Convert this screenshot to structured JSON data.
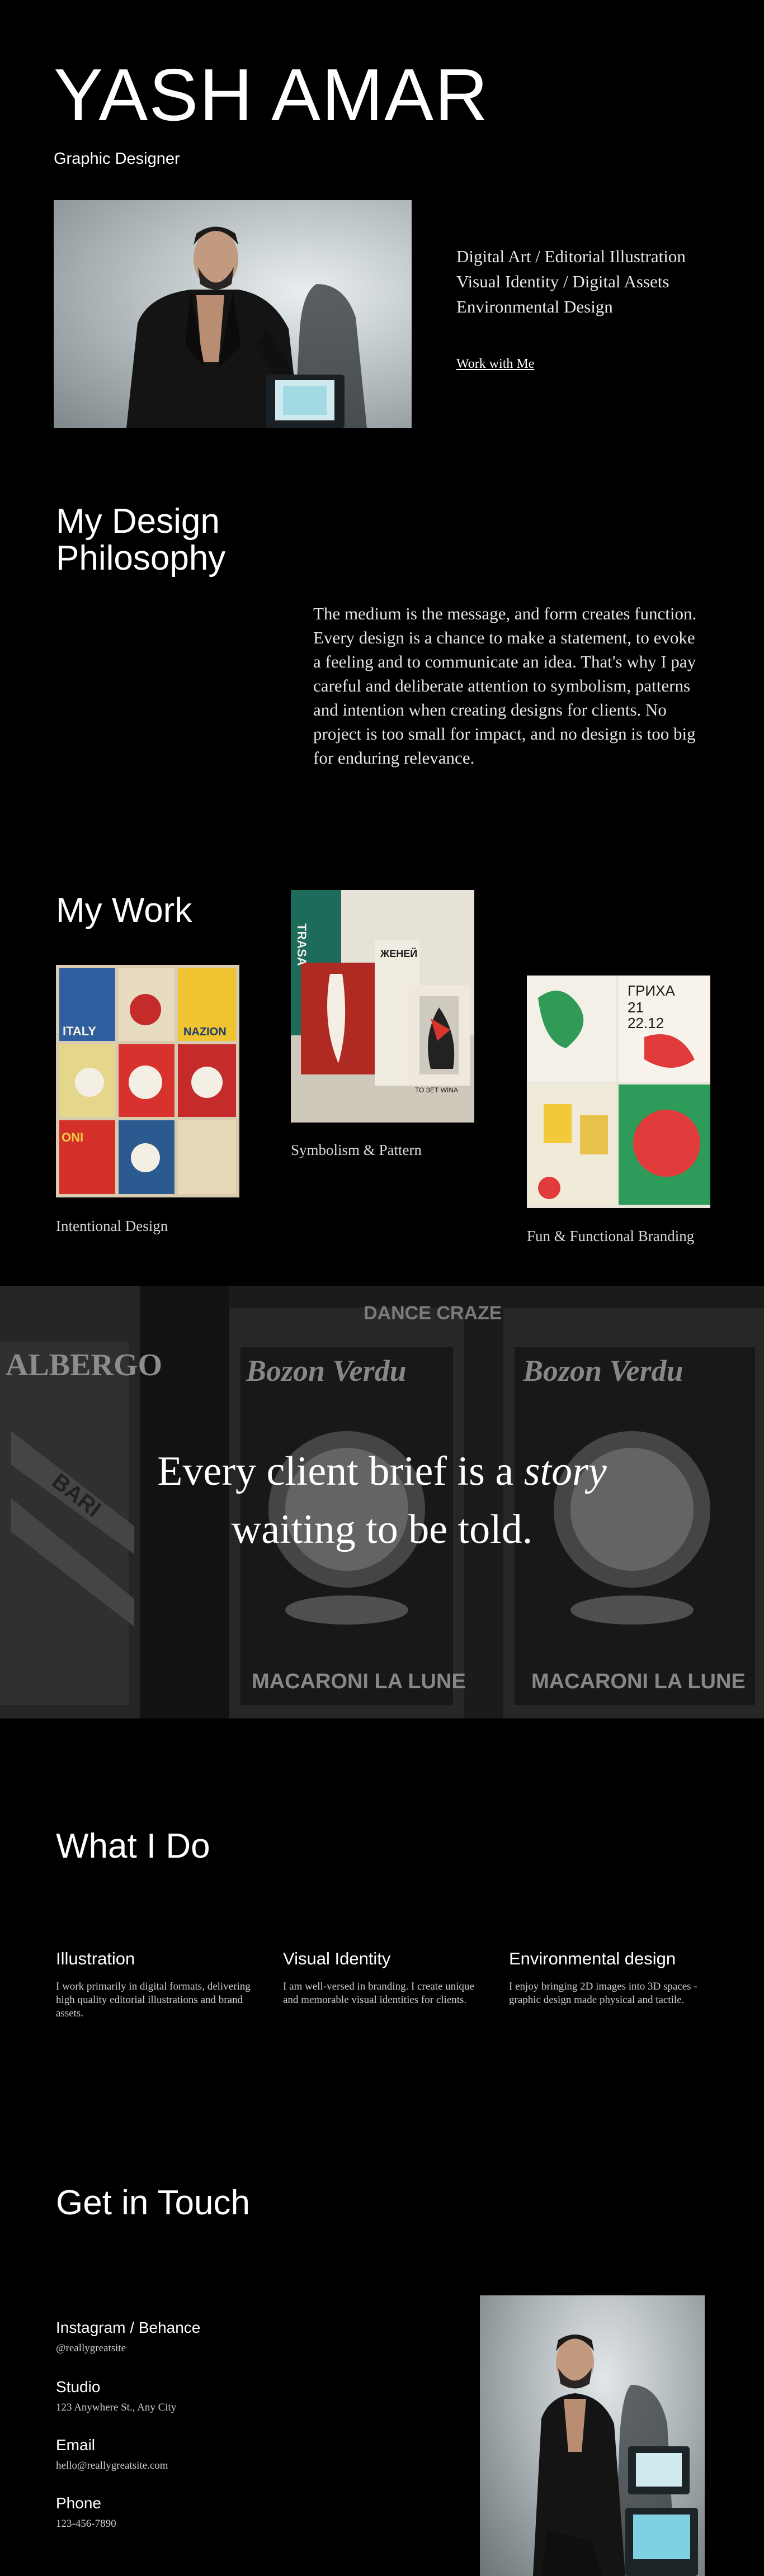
{
  "hero": {
    "name": "YASH AMAR",
    "role": "Graphic Designer",
    "services": [
      "Digital Art / Editorial Illustration",
      "Visual Identity / Digital Assets",
      "Environmental Design"
    ],
    "cta": "Work with Me"
  },
  "philosophy": {
    "title": "My Design Philosophy",
    "text": "The medium is the message, and form creates function. Every design is a chance to make a statement, to evoke a feeling and to communicate an idea. That's why I pay careful and deliberate attention to symbolism, patterns and intention when creating designs for clients. No project is too small for impact, and no design is too big for enduring relevance."
  },
  "work": {
    "title": "My Work",
    "items": [
      {
        "caption": "Intentional Design",
        "poster_text": [
          "ITALY",
          "NAZION",
          "ONI"
        ]
      },
      {
        "caption": "Symbolism & Pattern",
        "poster_text": [
          "TRASA",
          "ЖЕНЕЙ",
          "TO ЗЕТ WINA"
        ]
      },
      {
        "caption": "Fun & Functional Branding",
        "poster_text": [
          "ГРИХА",
          "21",
          "22.12"
        ]
      }
    ]
  },
  "banner": {
    "quote_before": "Every client brief is a ",
    "quote_em": "story",
    "quote_after": "waiting to be told.",
    "poster_text": [
      "ALBERGO",
      "BARI",
      "Bozon Verdu",
      "Bozon Verdu",
      "MACARONI LA LUNE",
      "MACARONI LA LUNE",
      "DANCE CRAZE"
    ]
  },
  "services": {
    "title": "What I Do",
    "items": [
      {
        "title": "Illustration",
        "text": "I work primarily in digital formats, delivering high quality editorial illustrations and brand assets."
      },
      {
        "title": "Visual Identity",
        "text": "I am well-versed in branding. I create unique and memorable visual identities for clients."
      },
      {
        "title": "Environmental design",
        "text": "I enjoy bringing 2D images into 3D spaces - graphic design made physical and tactile."
      }
    ]
  },
  "contact": {
    "title": "Get in Touch",
    "items": [
      {
        "label": "Instagram / Behance",
        "value": "@reallygreatsite"
      },
      {
        "label": "Studio",
        "value": "123 Anywhere St., Any City"
      },
      {
        "label": "Email",
        "value": "hello@reallygreatsite.com"
      },
      {
        "label": "Phone",
        "value": "123-456-7890"
      }
    ]
  }
}
